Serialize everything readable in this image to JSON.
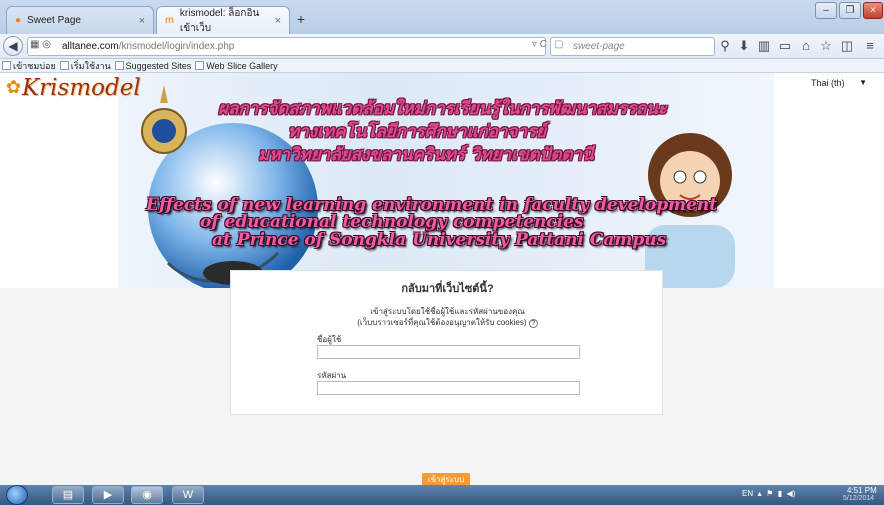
{
  "tabs": [
    {
      "label": "Sweet Page",
      "active": false
    },
    {
      "label": "krismodel: ล็อกอินเข้าเว็บ",
      "active": true
    }
  ],
  "navbar": {
    "url_host": "alltanee.com",
    "url_path": "/krismodel/login/index.php",
    "search_placeholder": "sweet-page"
  },
  "bookmarks": [
    "เข้าชมบ่อย",
    "เริ่มใช้งาน",
    "Suggested Sites",
    "Web Slice Gallery"
  ],
  "site": {
    "logo": "Krismodel",
    "language": "Thai (th)",
    "thai_title": [
      "ผลการจัดสภาพแวดล้อมใหม่การเรียนรู้ในการพัฒนาสมรรถนะ",
      "ทางเทคโนโลยีการศึกษาแก่อาจารย์",
      "มหาวิทยาลัยสงขลานครินทร์ วิทยาเขตปัตตานี"
    ],
    "english_title": [
      "Effects of new learning environment in faculty development",
      "of educational technology competencies",
      "at Prince of Songkla University Pattani Campus"
    ]
  },
  "login": {
    "title": "กลับมาที่เว็บไซต์นี้?",
    "desc_line1": "เข้าสู่ระบบโดยใช้ชื่อผู้ใช้และรหัสผ่านของคุณ",
    "desc_line2": "(เว็บบราวเซอร์ที่คุณใช้ต้องอนุญาตให้รับ cookies)",
    "username_label": "ชื่อผู้ใช้",
    "password_label": "รหัสผ่าน",
    "button_label": "เข้าสู่ระบบ"
  },
  "taskbar": {
    "lang": "EN",
    "time": "4:51 PM",
    "date": "5/12/2014"
  },
  "colors": {
    "accent": "#f29c38",
    "title_pink": "#e14a8a"
  }
}
